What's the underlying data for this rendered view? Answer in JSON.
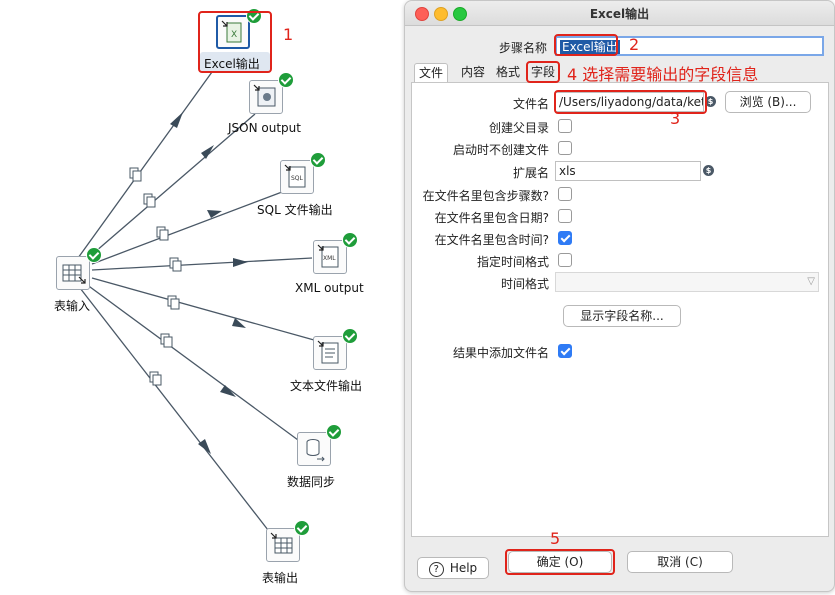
{
  "canvas": {
    "nodes": [
      {
        "id": "excel",
        "label": "Excel输出",
        "icon": "excel-output-icon"
      },
      {
        "id": "json",
        "label": "JSON output",
        "icon": "json-output-icon"
      },
      {
        "id": "sql",
        "label": "SQL 文件输出",
        "icon": "sql-output-icon",
        "icon_text": "SQL"
      },
      {
        "id": "xml",
        "label": "XML output",
        "icon": "xml-output-icon",
        "icon_text": "XML"
      },
      {
        "id": "text",
        "label": "文本文件输出",
        "icon": "text-file-output-icon"
      },
      {
        "id": "sync",
        "label": "数据同步",
        "icon": "data-sync-icon"
      },
      {
        "id": "table_out",
        "label": "表输出",
        "icon": "table-output-icon"
      },
      {
        "id": "table_in",
        "label": "表输入",
        "icon": "table-input-icon"
      }
    ],
    "excel_icon_text": "X"
  },
  "annotations": {
    "a1": "1",
    "a2": "2",
    "a3": "3",
    "a4": "4 选择需要输出的字段信息",
    "a5": "5"
  },
  "dialog": {
    "title": "Excel输出",
    "step_name_label": "步骤名称",
    "step_name_value": "Excel输出",
    "tabs": [
      "文件",
      "内容",
      "格式",
      "字段"
    ],
    "filename_label": "文件名",
    "filename_value": "/Users/liyadong/data/kettle",
    "browse_label": "浏览 (B)...",
    "create_parent_label": "创建父目录",
    "no_create_on_start_label": "启动时不创建文件",
    "extension_label": "扩展名",
    "extension_value": "xls",
    "include_stepnr_label": "在文件名里包含步骤数?",
    "include_date_label": "在文件名里包含日期?",
    "include_time_label": "在文件名里包含时间?",
    "specify_time_format_label": "指定时间格式",
    "time_format_label": "时间格式",
    "time_format_value": "",
    "show_fields_label": "显示字段名称...",
    "add_to_result_label": "结果中添加文件名",
    "checks": {
      "create_parent": false,
      "no_create_on_start": false,
      "include_stepnr": false,
      "include_date": false,
      "include_time": true,
      "specify_time_format": false,
      "add_to_result": true
    },
    "help_label": "Help",
    "help_icon": "?",
    "ok_label": "确定 (O)",
    "cancel_label": "取消 (C)",
    "dollar_glyph": "$",
    "dropdown_glyph": "▽"
  },
  "colors": {
    "accent": "#e0241b",
    "success": "#1f9d3a",
    "checkbox": "#2f7bf5",
    "selection": "#1f5aa6"
  }
}
